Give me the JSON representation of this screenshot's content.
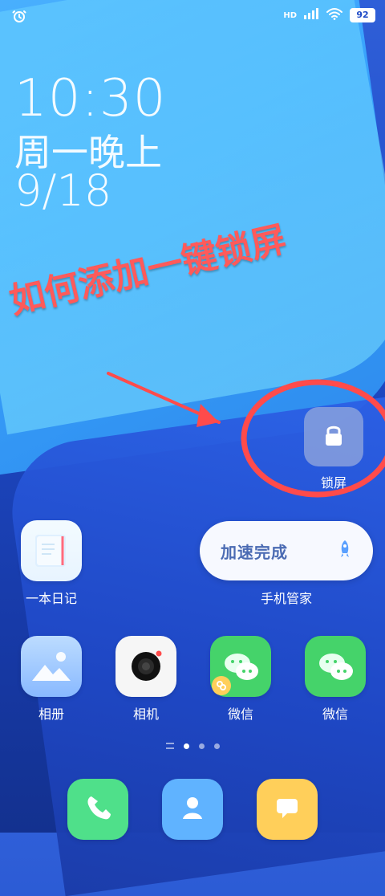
{
  "status_bar": {
    "alarm_icon": "alarm-clock-icon",
    "network": "HD",
    "wifi_icon": "wifi-icon",
    "signal_icon": "signal-icon",
    "battery": "92"
  },
  "clock": {
    "time": "10:30",
    "day": "周一晚上",
    "date": "9/18"
  },
  "overlay": {
    "title": "如何添加一键锁屏",
    "accent_color": "#ff4b4b"
  },
  "lock_widget": {
    "label": "锁屏",
    "icon": "lock-icon"
  },
  "apps": {
    "diary": {
      "label": "一本日记",
      "icon": "notebook-icon"
    },
    "manager": {
      "widget_text": "加速完成",
      "label": "手机管家",
      "icon": "rocket-icon"
    },
    "gallery": {
      "label": "相册",
      "icon": "gallery-icon"
    },
    "camera": {
      "label": "相机",
      "icon": "camera-icon"
    },
    "wechat_1": {
      "label": "微信",
      "icon": "wechat-icon"
    },
    "wechat_2": {
      "label": "微信",
      "icon": "wechat-icon"
    }
  },
  "dock": [
    {
      "icon": "phone-icon"
    },
    {
      "icon": "contacts-icon"
    },
    {
      "icon": "messages-icon"
    }
  ],
  "page_indicator": {
    "active_index": 1,
    "count": 3
  }
}
